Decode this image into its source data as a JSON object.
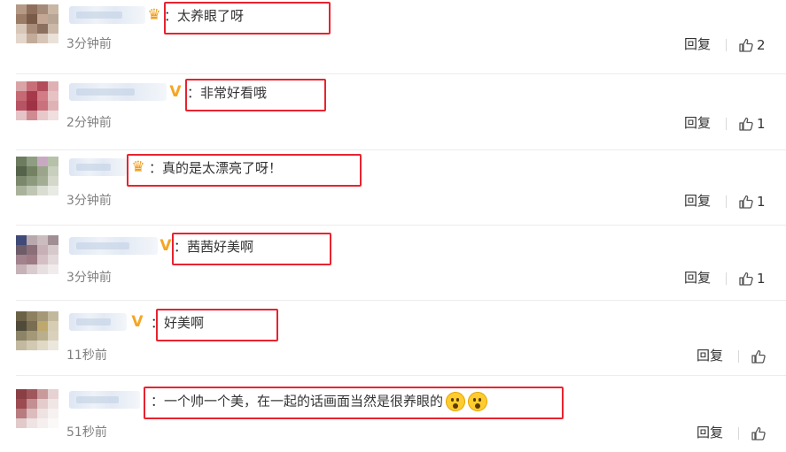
{
  "comments": [
    {
      "badge": "crown",
      "text": "：太养眼了呀",
      "time": "3分钟前",
      "reply_label": "回复",
      "like_count": "2",
      "emoji_count": 0,
      "avatar_colors": [
        "#b49a86",
        "#8f6e5c",
        "#a48a78",
        "#c9b6a5",
        "#9b7c66",
        "#7a5a48",
        "#c4a794",
        "#b9a595",
        "#d8c7b8",
        "#a98d7a",
        "#8c705f",
        "#cbb8a8",
        "#e3d6cb",
        "#c2ab99",
        "#d7c6b7",
        "#eae1d8"
      ]
    },
    {
      "badge": "vip",
      "text": "：非常好看哦",
      "time": "2分钟前",
      "reply_label": "回复",
      "like_count": "1",
      "emoji_count": 0,
      "avatar_colors": [
        "#d9a4a7",
        "#c86e78",
        "#b24c5b",
        "#e0b1b4",
        "#c56a74",
        "#a63a4b",
        "#d17c86",
        "#e7c2c4",
        "#b65464",
        "#9f3346",
        "#c9727d",
        "#dfb2b6",
        "#e4c4c6",
        "#cf8a92",
        "#e8c9cb",
        "#f1dedf"
      ]
    },
    {
      "badge": "crown",
      "text": "：真的是太漂亮了呀！",
      "time": "3分钟前",
      "reply_label": "回复",
      "like_count": "1",
      "emoji_count": 0,
      "avatar_colors": [
        "#6d7c5e",
        "#8f9d83",
        "#c9a9c2",
        "#b7c1aa",
        "#55634a",
        "#748263",
        "#9aa58c",
        "#c8cfbd",
        "#7b886b",
        "#8e9a7e",
        "#a3ad94",
        "#d3d8cb",
        "#a9b39c",
        "#bfc6b4",
        "#d9ddd2",
        "#e8ebe4"
      ]
    },
    {
      "badge": "vip",
      "text": "：茜茜好美啊",
      "time": "3分钟前",
      "reply_label": "回复",
      "like_count": "1",
      "emoji_count": 0,
      "avatar_colors": [
        "#3f4a78",
        "#b9a9ae",
        "#cbbcc0",
        "#a08e94",
        "#6e5c68",
        "#8a6f79",
        "#c7b0b6",
        "#d6c9cc",
        "#a2828c",
        "#9d7a84",
        "#d3bfc4",
        "#e3d8da",
        "#c6b2b7",
        "#d9cbce",
        "#e8dfe1",
        "#f1ebec"
      ]
    },
    {
      "badge": "vip",
      "text": "：好美啊",
      "time": "11秒前",
      "reply_label": "回复",
      "like_count": "",
      "emoji_count": 0,
      "avatar_colors": [
        "#6b6146",
        "#8c8060",
        "#a49877",
        "#c2b99d",
        "#4f4a3a",
        "#7a6e52",
        "#bfa86e",
        "#d6cdb4",
        "#8d8468",
        "#a39878",
        "#b9ae8e",
        "#d9d1bb",
        "#c2b9a0",
        "#d1c9b2",
        "#e0d9c6",
        "#ece7dc"
      ]
    },
    {
      "badge": "none",
      "text": "：一个帅一个美，在一起的话画面当然是很养眼的",
      "time": "51秒前",
      "reply_label": "回复",
      "like_count": "",
      "emoji_count": 2,
      "avatar_colors": [
        "#8a3f45",
        "#a0575c",
        "#c89a9c",
        "#e6d2d2",
        "#9c4b51",
        "#c48f92",
        "#e4cccc",
        "#f1e6e6",
        "#b87c80",
        "#dcbcbd",
        "#efe2e2",
        "#f7f1f1",
        "#e2caca",
        "#efe3e3",
        "#f6efef",
        "#fbf8f8"
      ]
    }
  ],
  "colors": {
    "highlight": "#e8232f",
    "time": "#808080",
    "text": "#333333",
    "separator": "#ececec"
  }
}
